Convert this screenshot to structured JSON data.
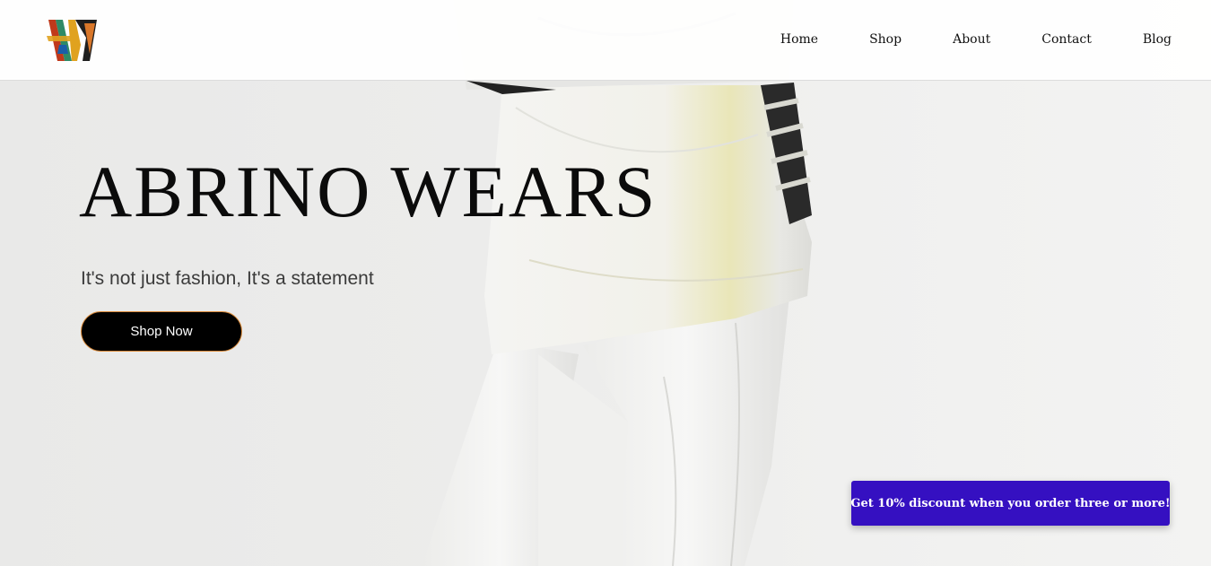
{
  "header": {
    "logo_icon": "aw-monogram-logo",
    "nav": [
      {
        "label": "Home"
      },
      {
        "label": "Shop"
      },
      {
        "label": "About"
      },
      {
        "label": "Contact"
      },
      {
        "label": "Blog"
      }
    ]
  },
  "hero": {
    "title": "ABRINO WEARS",
    "subtitle": "It's not just fashion, It's a statement",
    "cta_label": "Shop Now"
  },
  "promo": {
    "discount_label": "Get 10% discount when you order three or more!"
  },
  "colors": {
    "cta_background": "#000000",
    "cta_border": "#d98a3a",
    "promo_background": "#3510c1",
    "header_background": "#ffffff"
  }
}
